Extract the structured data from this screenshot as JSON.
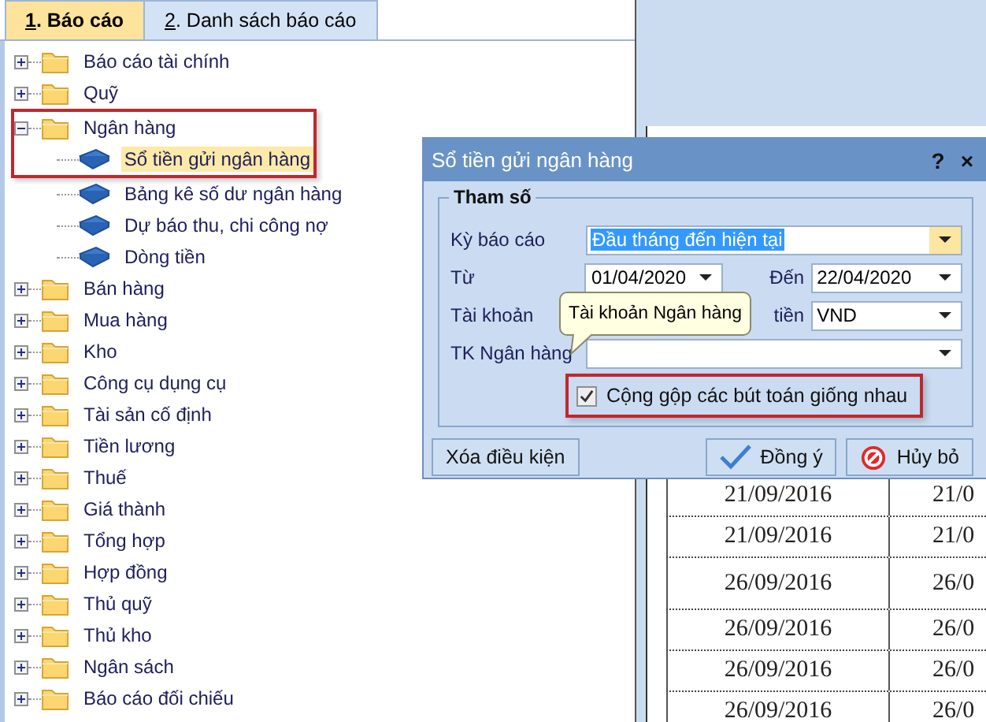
{
  "tabs": [
    {
      "label": "1. Báo cáo",
      "selected": true
    },
    {
      "label": "2. Danh sách báo cáo",
      "selected": false
    }
  ],
  "tree": [
    {
      "label": "Báo cáo tài chính",
      "kind": "folder",
      "expanded": false
    },
    {
      "label": "Quỹ",
      "kind": "folder",
      "expanded": false
    },
    {
      "label": "Ngân hàng",
      "kind": "folder",
      "expanded": true,
      "framed": true,
      "children": [
        {
          "label": "Sổ tiền gửi ngân hàng",
          "kind": "book",
          "selected": true,
          "framed": true
        },
        {
          "label": "Bảng kê số dư ngân hàng",
          "kind": "book",
          "selected": false
        },
        {
          "label": "Dự báo thu, chi công nợ",
          "kind": "book",
          "selected": false
        },
        {
          "label": "Dòng tiền",
          "kind": "book",
          "selected": false
        }
      ]
    },
    {
      "label": "Bán hàng",
      "kind": "folder",
      "expanded": false
    },
    {
      "label": "Mua hàng",
      "kind": "folder",
      "expanded": false
    },
    {
      "label": "Kho",
      "kind": "folder",
      "expanded": false
    },
    {
      "label": "Công cụ dụng cụ",
      "kind": "folder",
      "expanded": false
    },
    {
      "label": "Tài sản cố định",
      "kind": "folder",
      "expanded": false
    },
    {
      "label": "Tiền lương",
      "kind": "folder",
      "expanded": false
    },
    {
      "label": "Thuế",
      "kind": "folder",
      "expanded": false
    },
    {
      "label": "Giá thành",
      "kind": "folder",
      "expanded": false
    },
    {
      "label": "Tổng hợp",
      "kind": "folder",
      "expanded": false
    },
    {
      "label": "Hợp đồng",
      "kind": "folder",
      "expanded": false
    },
    {
      "label": "Thủ quỹ",
      "kind": "folder",
      "expanded": false
    },
    {
      "label": "Thủ kho",
      "kind": "folder",
      "expanded": false
    },
    {
      "label": "Ngân sách",
      "kind": "folder",
      "expanded": false
    },
    {
      "label": "Báo cáo đối chiếu",
      "kind": "folder",
      "expanded": false
    }
  ],
  "report_rows": [
    {
      "column_1": "21/09/2016",
      "column_2": "21/0"
    },
    {
      "column_1": "21/09/2016",
      "column_2": "21/0"
    },
    {
      "column_1": "26/09/2016",
      "column_2": "26/0"
    },
    {
      "column_1": "26/09/2016",
      "column_2": "26/0"
    },
    {
      "column_1": "26/09/2016",
      "column_2": "26/0"
    },
    {
      "column_1": "26/09/2016",
      "column_2": "26/0"
    }
  ],
  "dialog": {
    "title": "Sổ tiền gửi ngân hàng",
    "help": "?",
    "close": "×",
    "group_title": "Tham số",
    "rows": [
      {
        "fields": [
          {
            "label": "Kỳ báo cáo",
            "value": "Đầu tháng đến hiện tại",
            "value_selected": true,
            "focused": true
          }
        ]
      },
      {
        "fields": [
          {
            "label": "Từ",
            "value": "01/04/2020",
            "value_selected": false,
            "focused": false
          },
          {
            "label": "Đến",
            "value": "22/04/2020",
            "value_selected": false,
            "focused": false
          }
        ]
      },
      {
        "fields": [
          {
            "label": "Tài khoản"
          },
          {
            "label": "tiền",
            "value": "VND",
            "value_selected": false,
            "focused": false
          }
        ]
      },
      {
        "fields": [
          {
            "label": "TK Ngân hàng",
            "focused": false
          }
        ]
      }
    ],
    "checkbox": {
      "label": "Cộng gộp các bút toán giống nhau",
      "checked": true,
      "framed": true
    },
    "tooltip": "Tài khoản Ngân hàng",
    "buttons": [
      {
        "label": "Xóa điều kiện",
        "kind": "plain"
      },
      {
        "label": "Đồng ý",
        "kind": "confirm"
      },
      {
        "label": "Hủy bỏ",
        "kind": "cancel"
      }
    ]
  }
}
